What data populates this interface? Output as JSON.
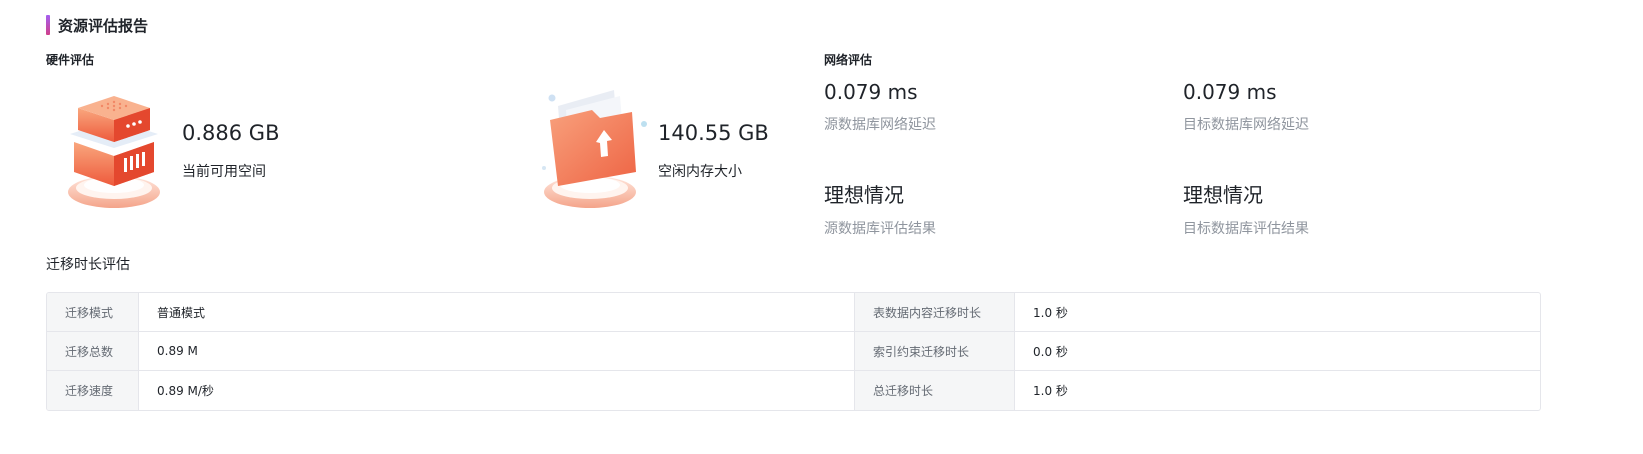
{
  "report": {
    "title": "资源评估报告"
  },
  "hardware": {
    "heading": "硬件评估",
    "cards": [
      {
        "value": "0.886 GB",
        "label": "当前可用空间",
        "icon": "server-stack-icon"
      },
      {
        "value": "140.55 GB",
        "label": "空闲内存大小",
        "icon": "folder-upload-icon"
      }
    ]
  },
  "network": {
    "heading": "网络评估",
    "items": [
      {
        "value": "0.079 ms",
        "label": "源数据库网络延迟"
      },
      {
        "value": "0.079 ms",
        "label": "目标数据库网络延迟"
      },
      {
        "value": "理想情况",
        "label": "源数据库评估结果"
      },
      {
        "value": "理想情况",
        "label": "目标数据库评估结果"
      }
    ]
  },
  "migration": {
    "heading": "迁移时长评估",
    "rows": [
      {
        "label1": "迁移模式",
        "value1": "普通模式",
        "label2": "表数据内容迁移时长",
        "value2": "1.0 秒"
      },
      {
        "label1": "迁移总数",
        "value1": "0.89 M",
        "label2": "索引约束迁移时长",
        "value2": "0.0 秒"
      },
      {
        "label1": "迁移速度",
        "value1": "0.89 M/秒",
        "label2": "总迁移时长",
        "value2": "1.0 秒"
      }
    ]
  },
  "colors": {
    "accent_start": "#a45ff0",
    "accent_end": "#d0408a",
    "illustration_orange": "#f0714e",
    "muted_text": "#8f959e"
  }
}
